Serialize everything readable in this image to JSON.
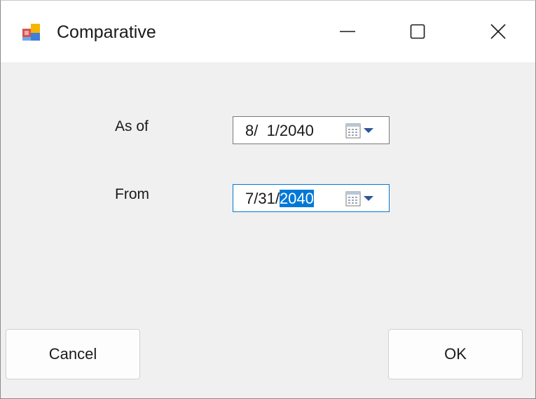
{
  "window": {
    "title": "Comparative",
    "icon": "windows-form-icon",
    "controls": [
      "minimize-icon",
      "maximize-icon",
      "close-icon"
    ]
  },
  "form": {
    "as_of": {
      "label": "As of",
      "value": "8/  1/2040"
    },
    "from": {
      "label": "From",
      "value_prefix": "7/31/",
      "value_selected": "2040"
    }
  },
  "buttons": {
    "cancel": "Cancel",
    "ok": "OK"
  },
  "colors": {
    "selection": "#0078d7",
    "focus_border": "#0078d7",
    "dropdown_arrow": "#2b5797"
  }
}
